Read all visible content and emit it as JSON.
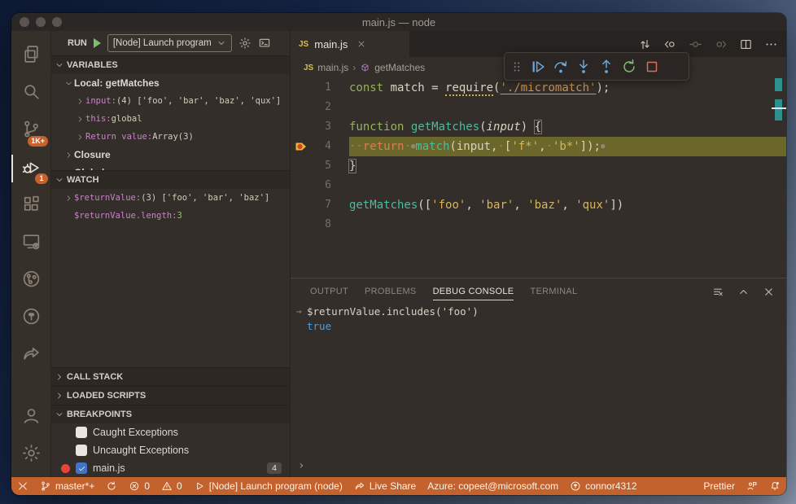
{
  "window": {
    "title": "main.js — node"
  },
  "activity_bar": {
    "items": [
      {
        "name": "explorer",
        "icon": "files"
      },
      {
        "name": "search",
        "icon": "search"
      },
      {
        "name": "source-control",
        "icon": "branch",
        "badge": "1K+"
      },
      {
        "name": "run-debug",
        "icon": "debug",
        "badge": "1",
        "active": true
      },
      {
        "name": "extensions",
        "icon": "extensions"
      },
      {
        "name": "remote-explorer",
        "icon": "remote"
      },
      {
        "name": "project-graph",
        "icon": "circle-branch"
      },
      {
        "name": "github",
        "icon": "github"
      },
      {
        "name": "live-share",
        "icon": "share"
      }
    ],
    "bottom": [
      {
        "name": "accounts",
        "icon": "account"
      },
      {
        "name": "settings",
        "icon": "gear"
      }
    ]
  },
  "run_bar": {
    "label": "RUN",
    "config": "[Node] Launch program"
  },
  "sidebar": {
    "variables": {
      "title": "VARIABLES",
      "items": [
        {
          "type": "group",
          "chevron": "down",
          "label": "Local: getMatches",
          "indent": 1
        },
        {
          "type": "kv",
          "chevron": "right",
          "key": "input:",
          "value": " (4) ['foo', 'bar', 'baz', 'qux']",
          "indent": 2
        },
        {
          "type": "kv",
          "chevron": "right",
          "key": "this:",
          "value": " global",
          "indent": 2
        },
        {
          "type": "kv",
          "chevron": "right",
          "key": "Return value:",
          "value": " Array(3)",
          "indent": 2
        },
        {
          "type": "group",
          "chevron": "right",
          "label": "Closure",
          "indent": 1
        },
        {
          "type": "group",
          "chevron": "right",
          "label": "Global",
          "indent": 1
        }
      ]
    },
    "watch": {
      "title": "WATCH",
      "items": [
        {
          "chevron": "right",
          "key": "$returnValue:",
          "value": " (3) ['foo', 'bar', 'baz']",
          "value_class": ""
        },
        {
          "chevron": "",
          "key": "$returnValue.length:",
          "value": " 3",
          "value_class": "num"
        }
      ]
    },
    "collapsed_sections": [
      "CALL STACK",
      "LOADED SCRIPTS"
    ],
    "breakpoints": {
      "title": "BREAKPOINTS",
      "items": [
        {
          "label": "Caught Exceptions",
          "checked": false,
          "dot": false
        },
        {
          "label": "Uncaught Exceptions",
          "checked": false,
          "dot": false
        },
        {
          "label": "main.js",
          "checked": true,
          "dot": true,
          "badge": "4"
        }
      ]
    }
  },
  "editor": {
    "tab": {
      "icon": "JS",
      "label": "main.js"
    },
    "breadcrumb": {
      "file_icon": "JS",
      "file": "main.js",
      "symbol": "getMatches"
    },
    "actions": [
      {
        "name": "open-changes",
        "icon": "compare",
        "dim": false
      },
      {
        "name": "previous-change",
        "icon": "nav-back",
        "dim": false
      },
      {
        "name": "current-change",
        "icon": "nav-circle",
        "dim": true
      },
      {
        "name": "next-change",
        "icon": "nav-forward",
        "dim": true
      },
      {
        "name": "split-editor",
        "icon": "split",
        "dim": false
      },
      {
        "name": "more-actions",
        "icon": "more",
        "dim": false
      }
    ],
    "lines": [
      {
        "n": "1",
        "tokens": [
          [
            "const ",
            "kw"
          ],
          [
            "match ",
            "txt"
          ],
          [
            "= ",
            "txt"
          ],
          [
            "require",
            "txt rq"
          ],
          [
            "(",
            "txt"
          ],
          [
            "'./micromatch'",
            "str2"
          ],
          [
            ");",
            "txt"
          ]
        ]
      },
      {
        "n": "2",
        "tokens": []
      },
      {
        "n": "3",
        "tokens": [
          [
            "function ",
            "kw"
          ],
          [
            "getMatches",
            "fn"
          ],
          [
            "(",
            "txt"
          ],
          [
            "input",
            "param"
          ],
          [
            ") ",
            "txt"
          ],
          [
            "{",
            "txt box"
          ]
        ]
      },
      {
        "n": "4",
        "highlight": true,
        "gutter": "bp-current",
        "tokens": [
          [
            "··",
            "ws"
          ],
          [
            "return",
            "ret"
          ],
          [
            "·",
            "ws"
          ],
          [
            "●",
            "ibp"
          ],
          [
            "match",
            "fn"
          ],
          [
            "(input,",
            "txt"
          ],
          [
            "·",
            "ws"
          ],
          [
            "[",
            "txt"
          ],
          [
            "'f*'",
            "str"
          ],
          [
            ",",
            "txt"
          ],
          [
            "·",
            "ws"
          ],
          [
            "'b*'",
            "str"
          ],
          [
            "]);",
            "txt"
          ],
          [
            "●",
            "ibp"
          ]
        ]
      },
      {
        "n": "5",
        "tokens": [
          [
            "}",
            "txt box"
          ]
        ]
      },
      {
        "n": "6",
        "tokens": []
      },
      {
        "n": "7",
        "tokens": [
          [
            "getMatches",
            "fn"
          ],
          [
            "([",
            "txt"
          ],
          [
            "'foo'",
            "str"
          ],
          [
            ", ",
            "txt"
          ],
          [
            "'bar'",
            "str"
          ],
          [
            ", ",
            "txt"
          ],
          [
            "'baz'",
            "str"
          ],
          [
            ", ",
            "txt"
          ],
          [
            "'qux'",
            "str"
          ],
          [
            "])",
            "txt"
          ]
        ]
      },
      {
        "n": "8",
        "tokens": []
      }
    ]
  },
  "debug_toolbar": {
    "buttons": [
      {
        "name": "continue"
      },
      {
        "name": "step-over"
      },
      {
        "name": "step-into"
      },
      {
        "name": "step-out"
      },
      {
        "name": "restart"
      },
      {
        "name": "stop"
      }
    ]
  },
  "panel": {
    "tabs": [
      {
        "label": "OUTPUT",
        "active": false
      },
      {
        "label": "PROBLEMS",
        "active": false
      },
      {
        "label": "DEBUG CONSOLE",
        "active": true
      },
      {
        "label": "TERMINAL",
        "active": false
      }
    ],
    "console": [
      {
        "gutter": "→",
        "text": "$returnValue.includes('foo')",
        "cls": "expr"
      },
      {
        "gutter": "",
        "text": "true",
        "cls": "result"
      }
    ],
    "prompt": "›"
  },
  "status_bar": {
    "left": [
      {
        "name": "remote",
        "icon": "remote-x",
        "text": ""
      },
      {
        "name": "branch",
        "icon": "scm-branch",
        "text": "master*+"
      },
      {
        "name": "sync",
        "icon": "sync",
        "text": ""
      },
      {
        "name": "errors",
        "icon": "error",
        "text": "0"
      },
      {
        "name": "warnings",
        "icon": "warning",
        "text": "0"
      },
      {
        "name": "debug-launch",
        "icon": "play",
        "text": "[Node] Launch program (node)"
      },
      {
        "name": "live-share",
        "icon": "share",
        "text": "Live Share"
      },
      {
        "name": "azure-account",
        "icon": "",
        "text": "Azure: copeet@microsoft.com"
      },
      {
        "name": "github-account",
        "icon": "github",
        "text": "connor4312"
      }
    ],
    "right": [
      {
        "name": "prettier",
        "icon": "",
        "text": "Prettier"
      },
      {
        "name": "feedback",
        "icon": "feedback",
        "text": ""
      },
      {
        "name": "notifications",
        "icon": "bell-dot",
        "text": ""
      }
    ]
  },
  "colors": {
    "status_bar": "#c4622d",
    "badge": "#c8612c",
    "line_highlight": "#6b672a",
    "overview_teal": "#2e8f8f",
    "variable_magenta": "#c983c9",
    "string_gold": "#d8b45c",
    "keyword_green": "#96b35c",
    "function_teal": "#48bda0",
    "return_coral": "#de7c52",
    "result_blue": "#4aa0e0",
    "breakpoint_red": "#e5453c",
    "checkbox_blue": "#3f74c8"
  }
}
